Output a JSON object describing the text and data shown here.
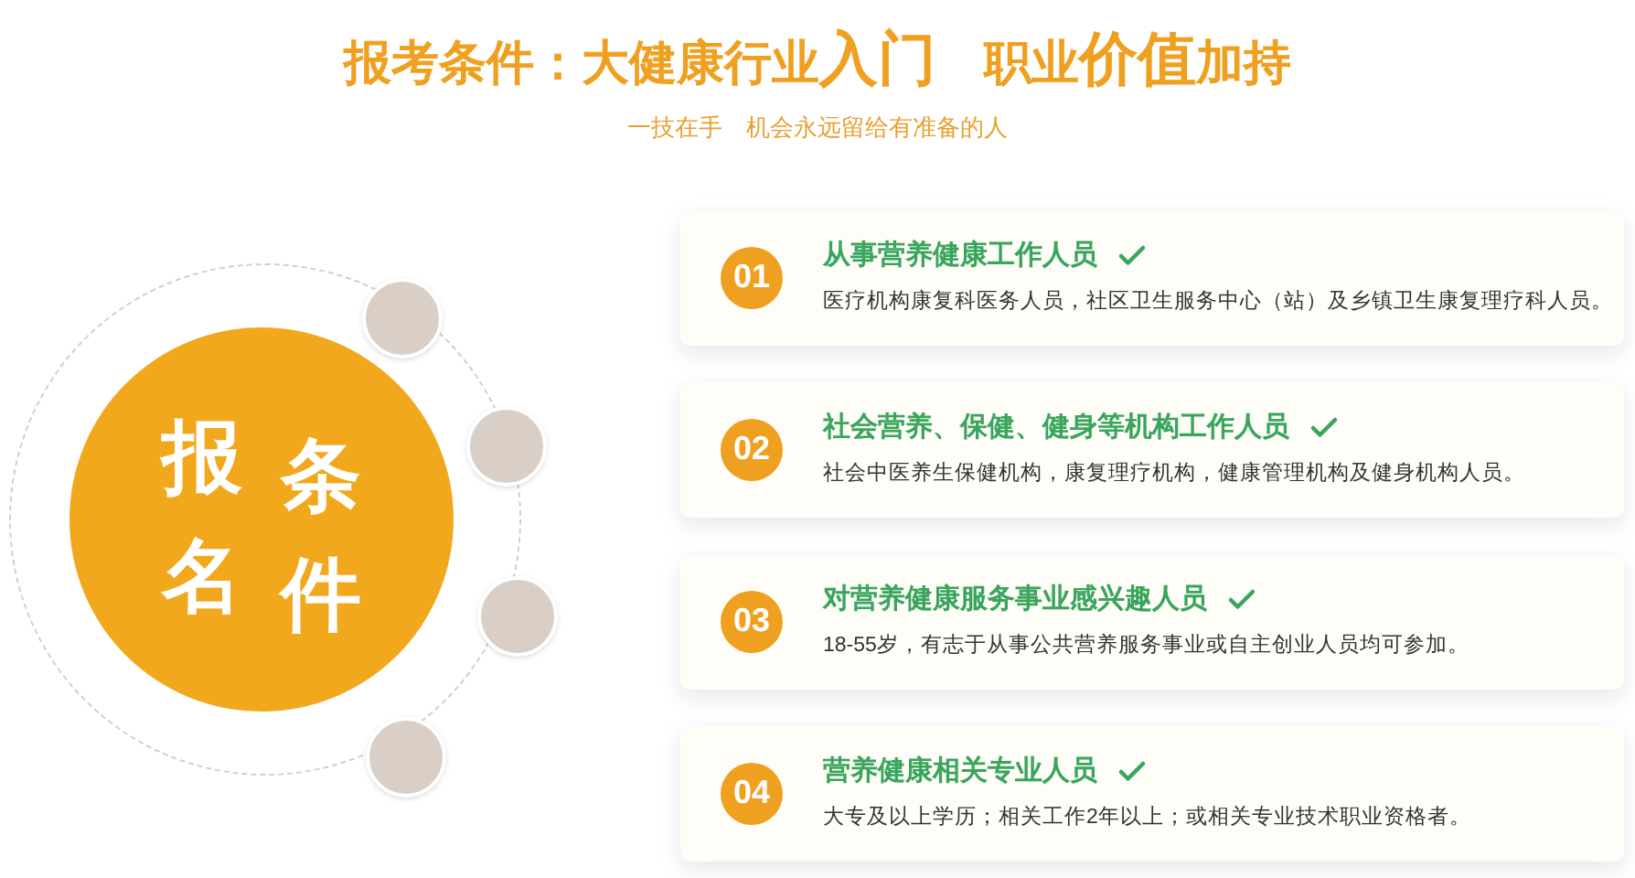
{
  "heading": {
    "parts": [
      {
        "text": "报考条件：大健康行业",
        "large": false
      },
      {
        "text": "入门",
        "large": true
      },
      {
        "text": "　职业",
        "large": false
      },
      {
        "text": "价值",
        "large": true
      },
      {
        "text": "加持",
        "large": false
      }
    ]
  },
  "subtitle": "一技在手　机会永远留给有准备的人",
  "badge": {
    "chars": [
      "报",
      "名",
      "条",
      "件"
    ]
  },
  "conditions": [
    {
      "number": "01",
      "title": "从事营养健康工作人员",
      "checked": true,
      "description": "医疗机构康复科医务人员，社区卫生服务中心（站）及乡镇卫生康复理疗科人员。"
    },
    {
      "number": "02",
      "title": "社会营养、保健、健身等机构工作人员",
      "checked": true,
      "description": "社会中医养生保健机构，康复理疗机构，健康管理机构及健身机构人员。"
    },
    {
      "number": "03",
      "title": "对营养健康服务事业感兴趣人员",
      "checked": true,
      "description": "18-55岁，有志于从事公共营养服务事业或自主创业人员均可参加。"
    },
    {
      "number": "04",
      "title": "营养健康相关专业人员",
      "checked": true,
      "description": "大专及以上学历；相关工作2年以上；或相关专业技术职业资格者。"
    }
  ]
}
